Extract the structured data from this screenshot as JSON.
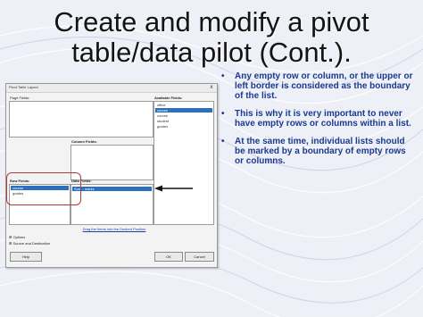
{
  "slide": {
    "title_line1": "Create and modify a pivot",
    "title_line2": "table/data pilot (Cont.).",
    "bullets": [
      "Any empty row or column, or the upper or left border is considered as the boundary of the list.",
      "This is why it is very important to never have empty rows or columns within a list.",
      "At the same time, individual lists should be marked by a boundary of empty rows or columns."
    ],
    "bullet_symbol": "•",
    "colors": {
      "title": "#141414",
      "bullet_text": "#1b3a8f",
      "highlight_ring": "#b33a3a",
      "selected_field": "#2e6fbd"
    }
  },
  "dialog": {
    "title": "Pivot Table Layout",
    "close_symbol": "x",
    "page_fields_label": "Page Fields:",
    "column_fields_label": "Column Fields:",
    "row_fields_label": "Row Fields:",
    "data_fields_label": "Data Fields:",
    "available_fields_label": "Available Fields:",
    "available_fields": [
      {
        "label": "office",
        "selected": false
      },
      {
        "label": "course",
        "selected": true
      },
      {
        "label": "course",
        "selected": false
      },
      {
        "label": "student",
        "selected": false
      },
      {
        "label": "grades",
        "selected": false
      }
    ],
    "row_fields": [
      {
        "label": "course",
        "selected": true
      },
      {
        "label": "grades",
        "selected": false
      }
    ],
    "data_fields": [
      {
        "label": "Sum - marks",
        "selected": true
      }
    ],
    "drag_hint": "Drag the Items into the Desired Position",
    "options_label": "Options",
    "source_label": "Source and Destination",
    "expand_symbol": "⊞",
    "help_button": "Help",
    "ok_button": "OK",
    "cancel_button": "Cancel"
  }
}
